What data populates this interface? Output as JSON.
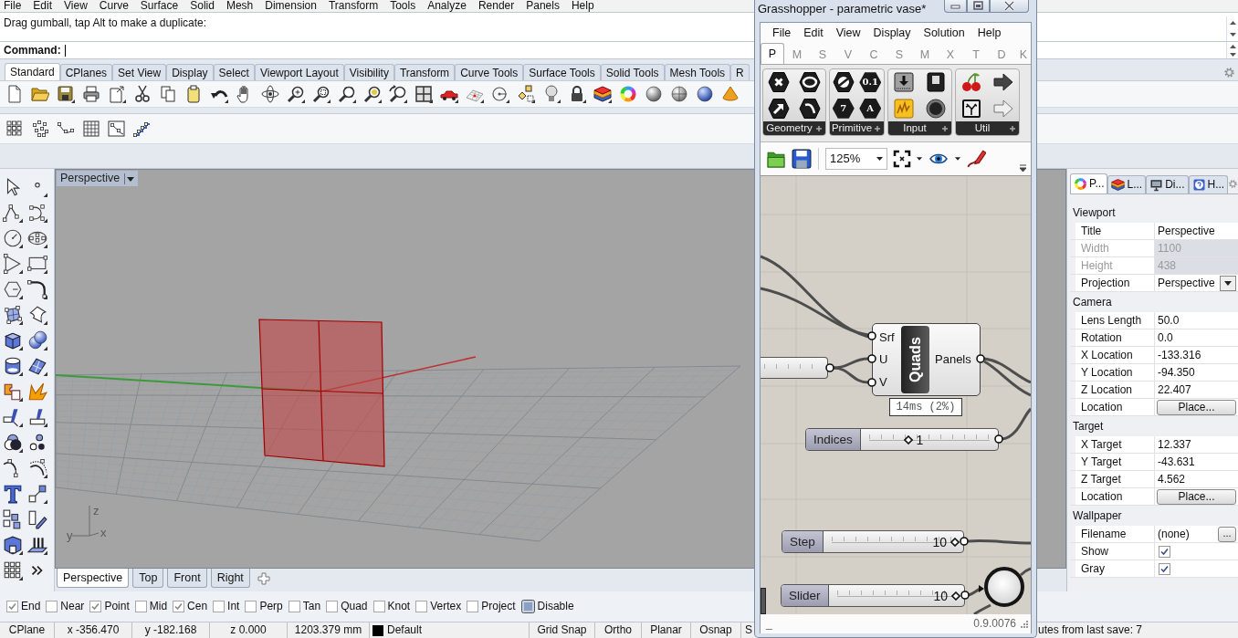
{
  "menu": [
    "File",
    "Edit",
    "View",
    "Curve",
    "Surface",
    "Solid",
    "Mesh",
    "Dimension",
    "Transform",
    "Tools",
    "Analyze",
    "Render",
    "Panels",
    "Help"
  ],
  "command": {
    "history": "Drag gumball, tap Alt to make a duplicate:",
    "prompt": "Command:"
  },
  "toolbar_tabs": [
    {
      "label": "Standard",
      "selected": true
    },
    {
      "label": "CPlanes",
      "selected": false
    },
    {
      "label": "Set View",
      "selected": false
    },
    {
      "label": "Display",
      "selected": false
    },
    {
      "label": "Select",
      "selected": false
    },
    {
      "label": "Viewport Layout",
      "selected": false
    },
    {
      "label": "Visibility",
      "selected": false
    },
    {
      "label": "Transform",
      "selected": false
    },
    {
      "label": "Curve Tools",
      "selected": false
    },
    {
      "label": "Surface Tools",
      "selected": false
    },
    {
      "label": "Solid Tools",
      "selected": false
    },
    {
      "label": "Mesh Tools",
      "selected": false
    },
    {
      "label": "R",
      "selected": false
    }
  ],
  "viewport": {
    "title": "Perspective",
    "axis_labels": [
      "z",
      "y",
      "x"
    ]
  },
  "viewport_tabs": [
    {
      "label": "Perspective",
      "selected": true
    },
    {
      "label": "Top",
      "selected": false
    },
    {
      "label": "Front",
      "selected": false
    },
    {
      "label": "Right",
      "selected": false
    }
  ],
  "osnaps": [
    {
      "label": "End",
      "checked": true,
      "kind": "checkbox"
    },
    {
      "label": "Near",
      "checked": false,
      "kind": "checkbox"
    },
    {
      "label": "Point",
      "checked": true,
      "kind": "checkbox"
    },
    {
      "label": "Mid",
      "checked": false,
      "kind": "checkbox"
    },
    {
      "label": "Cen",
      "checked": true,
      "kind": "checkbox"
    },
    {
      "label": "Int",
      "checked": false,
      "kind": "checkbox"
    },
    {
      "label": "Perp",
      "checked": false,
      "kind": "checkbox"
    },
    {
      "label": "Tan",
      "checked": false,
      "kind": "checkbox"
    },
    {
      "label": "Quad",
      "checked": false,
      "kind": "checkbox"
    },
    {
      "label": "Knot",
      "checked": false,
      "kind": "checkbox"
    },
    {
      "label": "Vertex",
      "checked": false,
      "kind": "checkbox"
    },
    {
      "label": "Project",
      "checked": false,
      "kind": "checkbox"
    },
    {
      "label": "Disable",
      "checked": false,
      "kind": "toggle"
    }
  ],
  "status_bar": [
    {
      "kind": "pane",
      "text": "CPlane"
    },
    {
      "kind": "pane",
      "text": "x -356.470"
    },
    {
      "kind": "pane",
      "text": "y -182.168"
    },
    {
      "kind": "pane",
      "text": "z 0.000"
    },
    {
      "kind": "pane",
      "text": "1203.379 mm"
    },
    {
      "kind": "layer",
      "text": "Default"
    },
    {
      "kind": "pane",
      "text": "Grid Snap"
    },
    {
      "kind": "pane",
      "text": "Ortho"
    },
    {
      "kind": "pane",
      "text": "Planar"
    },
    {
      "kind": "pane",
      "text": "Osnap"
    },
    {
      "kind": "pane",
      "text": "S"
    },
    {
      "kind": "message",
      "text": "utes from last save: 7"
    }
  ],
  "properties": {
    "tabs": [
      {
        "label": "P...",
        "selected": true
      },
      {
        "label": "L...",
        "selected": false
      },
      {
        "label": "Di...",
        "selected": false
      },
      {
        "label": "H...",
        "selected": false
      }
    ],
    "sections": [
      {
        "title": "Viewport",
        "rows": [
          {
            "label": "Title",
            "value": "Perspective",
            "kind": "text"
          },
          {
            "label": "Width",
            "value": "1100",
            "kind": "readonly"
          },
          {
            "label": "Height",
            "value": "438",
            "kind": "readonly"
          },
          {
            "label": "Projection",
            "value": "Perspective",
            "kind": "dropdown"
          }
        ]
      },
      {
        "title": "Camera",
        "rows": [
          {
            "label": "Lens Length",
            "value": "50.0",
            "kind": "text"
          },
          {
            "label": "Rotation",
            "value": "0.0",
            "kind": "text"
          },
          {
            "label": "X Location",
            "value": "-133.316",
            "kind": "text"
          },
          {
            "label": "Y Location",
            "value": "-94.350",
            "kind": "text"
          },
          {
            "label": "Z Location",
            "value": "22.407",
            "kind": "text"
          },
          {
            "label": "Location",
            "value": "Place...",
            "kind": "button"
          }
        ]
      },
      {
        "title": "Target",
        "rows": [
          {
            "label": "X Target",
            "value": "12.337",
            "kind": "text"
          },
          {
            "label": "Y Target",
            "value": "-43.631",
            "kind": "text"
          },
          {
            "label": "Z Target",
            "value": "4.562",
            "kind": "text"
          },
          {
            "label": "Location",
            "value": "Place...",
            "kind": "button"
          }
        ]
      },
      {
        "title": "Wallpaper",
        "rows": [
          {
            "label": "Filename",
            "value": "(none)",
            "kind": "file",
            "button": "..."
          },
          {
            "label": "Show",
            "kind": "checkbox",
            "checked": true
          },
          {
            "label": "Gray",
            "kind": "checkbox",
            "checked": true
          }
        ]
      }
    ]
  },
  "grasshopper": {
    "title": "Grasshopper - parametric vase*",
    "menu": [
      "File",
      "Edit",
      "View",
      "Display",
      "Solution",
      "Help"
    ],
    "tabs": [
      {
        "label": "P",
        "selected": true
      },
      {
        "label": "M",
        "selected": false
      },
      {
        "label": "S",
        "selected": false
      },
      {
        "label": "V",
        "selected": false
      },
      {
        "label": "C",
        "selected": false
      },
      {
        "label": "S",
        "selected": false
      },
      {
        "label": "M",
        "selected": false
      },
      {
        "label": "X",
        "selected": false
      },
      {
        "label": "T",
        "selected": false
      },
      {
        "label": "D",
        "selected": false
      },
      {
        "label": "K",
        "selected": false
      }
    ],
    "panels": [
      {
        "label": "Geometry"
      },
      {
        "label": "Primitive",
        "glyphs": [
          "0.1",
          "7",
          "A"
        ]
      },
      {
        "label": "Input"
      },
      {
        "label": "Util"
      }
    ],
    "zoom": "125%",
    "canvas": {
      "component": {
        "name": "Quads",
        "inputs": [
          "Srf",
          "U",
          "V"
        ],
        "outputs": [
          "Panels"
        ],
        "profiler": "14ms (2%)"
      },
      "sliders": [
        {
          "name": "Indices",
          "value": "1",
          "level": 0.33
        },
        {
          "name": "Step",
          "value": "10",
          "level": 1
        },
        {
          "name": "Slider",
          "value": "10",
          "level": 1
        }
      ]
    },
    "status_text": "_",
    "version": "0.9.0076"
  }
}
